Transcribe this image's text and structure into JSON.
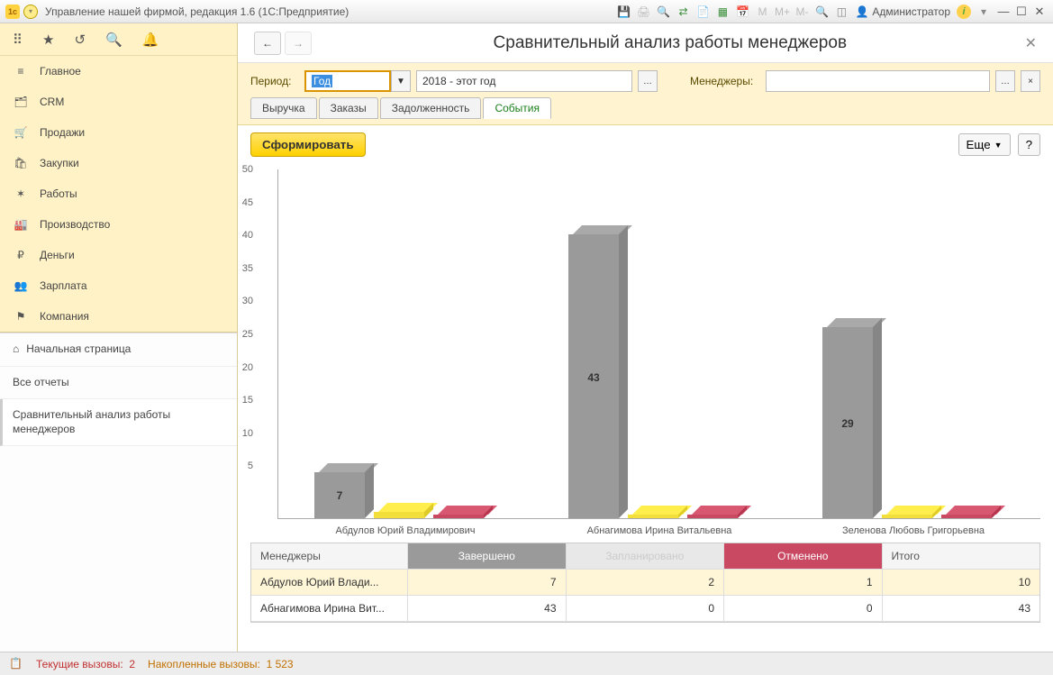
{
  "titlebar": {
    "title": "Управление нашей фирмой, редакция 1.6  (1С:Предприятие)",
    "user": "Администратор"
  },
  "nav": {
    "items": [
      {
        "icon": "≡",
        "label": "Главное"
      },
      {
        "icon": "🗂",
        "label": "CRM"
      },
      {
        "icon": "🛒",
        "label": "Продажи"
      },
      {
        "icon": "🛍",
        "label": "Закупки"
      },
      {
        "icon": "✶",
        "label": "Работы"
      },
      {
        "icon": "🏭",
        "label": "Производство"
      },
      {
        "icon": "₽",
        "label": "Деньги"
      },
      {
        "icon": "👥",
        "label": "Зарплата"
      },
      {
        "icon": "⚑",
        "label": "Компания"
      }
    ],
    "home": "Начальная страница",
    "all_reports": "Все отчеты",
    "current": "Сравнительный анализ работы менеджеров"
  },
  "page": {
    "title": "Сравнительный анализ работы менеджеров",
    "period_label": "Период:",
    "period_type": "Год",
    "period_value": "2018 - этот год",
    "managers_label": "Менеджеры:",
    "managers_value": "",
    "tabs": [
      "Выручка",
      "Заказы",
      "Задолженность",
      "События"
    ],
    "active_tab": 3,
    "form_btn": "Сформировать",
    "more_btn": "Еще",
    "help_btn": "?"
  },
  "chart_data": {
    "type": "bar",
    "ylim": [
      0,
      50
    ],
    "yticks": [
      5,
      10,
      15,
      20,
      25,
      30,
      35,
      40,
      45,
      50
    ],
    "categories": [
      "Абдулов Юрий Владимирович",
      "Абнагимова Ирина Витальевна",
      "Зеленова Любовь Григорьевна"
    ],
    "series": [
      {
        "name": "Завершено",
        "color": "#9a9a9a",
        "values": [
          7,
          43,
          29
        ]
      },
      {
        "name": "Запланировано",
        "color": "#f2df3c",
        "values": [
          1,
          0.3,
          0.3
        ]
      },
      {
        "name": "Отменено",
        "color": "#c94862",
        "values": [
          0.6,
          0.3,
          0.3
        ]
      }
    ],
    "value_labels": [
      "7",
      "43",
      "29"
    ]
  },
  "table": {
    "headers": [
      "Менеджеры",
      "Завершено",
      "Запланировано",
      "Отменено",
      "Итого"
    ],
    "rows": [
      {
        "name": "Абдулов Юрий Влади...",
        "done": 7,
        "plan": 2,
        "cancel": 1,
        "total": 10,
        "selected": true
      },
      {
        "name": "Абнагимова Ирина Вит...",
        "done": 43,
        "plan": 0,
        "cancel": 0,
        "total": 43,
        "selected": false
      }
    ]
  },
  "status": {
    "calls_label": "Текущие вызовы:",
    "calls": "2",
    "acc_label": "Накопленные вызовы:",
    "acc": "1 523"
  }
}
